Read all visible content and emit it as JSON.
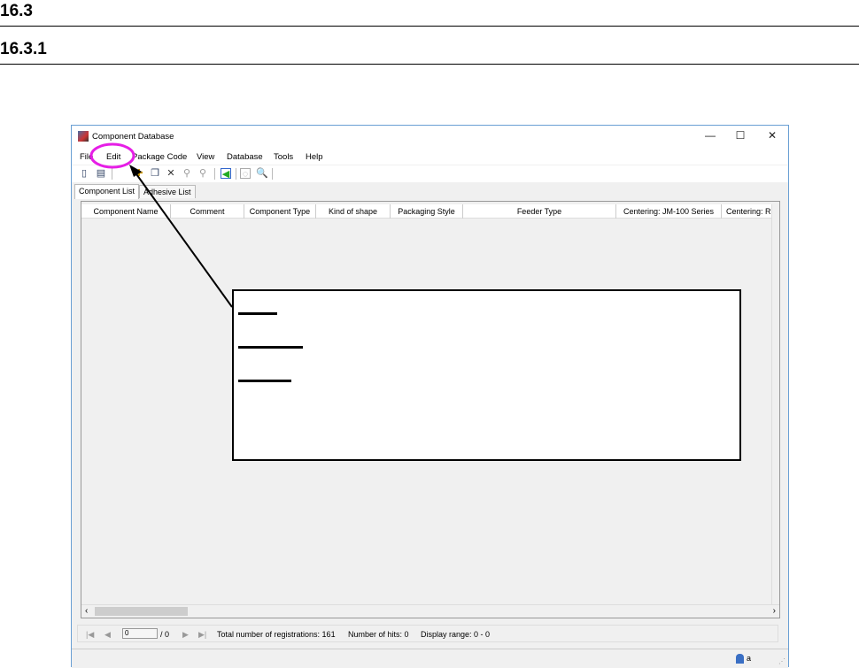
{
  "headings": {
    "h1": "16.3",
    "h2": "16.3.1"
  },
  "window": {
    "title": "Component Database",
    "minimize": "—",
    "maximize": "☐",
    "close": "✕"
  },
  "menu": [
    "File",
    "Edit",
    "Package Code",
    "View",
    "Database",
    "Tools",
    "Help"
  ],
  "tabs": [
    "Component List",
    "Adhesive List"
  ],
  "columns": [
    "Component Name",
    "Comment",
    "Component Type",
    "Kind of shape",
    "Packaging Style",
    "Feeder Type",
    "Centering: JM-100 Series",
    "Centering: RS-"
  ],
  "nav": {
    "page": "0",
    "total": "/ 0",
    "registrations": "Total number of registrations: 161",
    "hits": "Number of hits: 0",
    "range": "Display range: 0 - 0"
  },
  "status": {
    "user": "a"
  },
  "colors": {
    "highlight": "#e61ee6",
    "border": "#6a9fd4"
  }
}
